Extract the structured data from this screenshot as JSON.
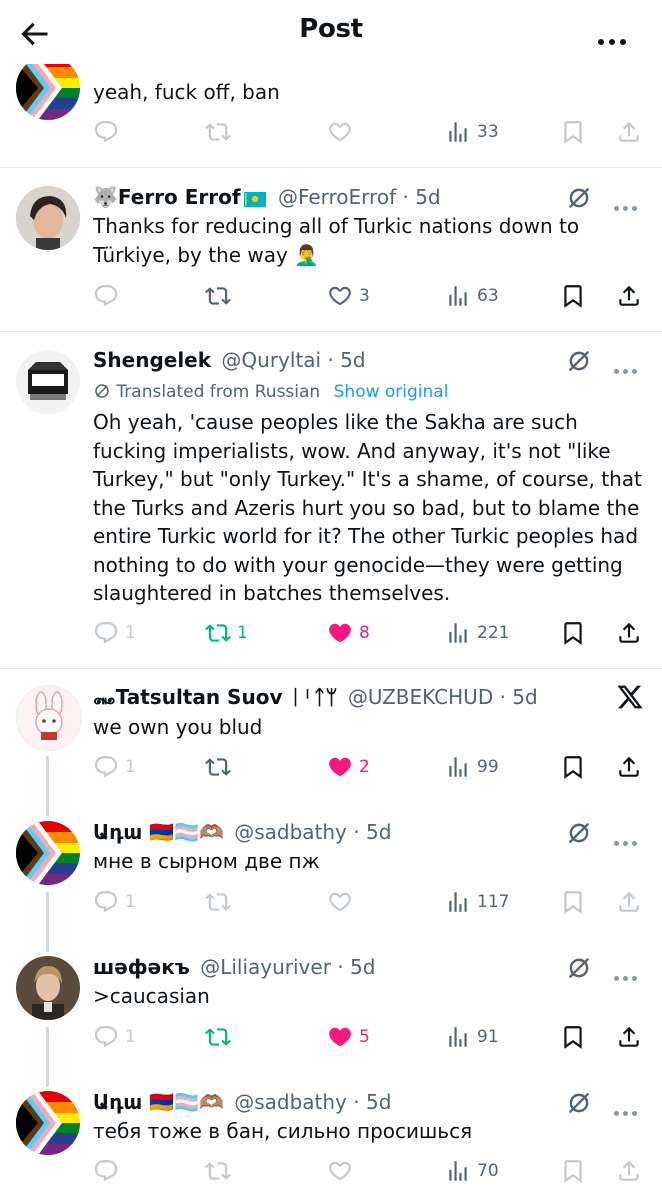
{
  "header": {
    "title": "Post"
  },
  "colors": {
    "retweet_active": "#00ba7c",
    "like_active": "#f91880",
    "link": "#1d9bf0",
    "muted": "#536471"
  },
  "icons": {
    "back": "arrow-left-icon",
    "more": "more-icon",
    "reply": "reply-icon",
    "retweet": "retweet-icon",
    "like": "heart-icon",
    "views": "views-icon",
    "bookmark": "bookmark-icon",
    "share": "share-icon",
    "grok": "grok-icon",
    "x_logo": "x-logo-icon"
  },
  "posts": [
    {
      "text": "yeah, fuck off, ban",
      "stats": {
        "views": "33"
      }
    },
    {
      "name": "🐺Ferro Errof",
      "handle": "@FerroErrof",
      "time": "· 5d",
      "text": "Thanks for reducing all of Turkic nations down to Türkiye, by the way 🤦‍♂️",
      "stats": {
        "likes": "3",
        "views": "63"
      }
    },
    {
      "name": "Shengelek",
      "handle": "@Quryltai",
      "time": "· 5d",
      "translated_label": "Translated from Russian",
      "show_original": "Show original",
      "text": "Oh yeah, 'cause peoples like the Sakha are such fucking imperialists, wow. And anyway, it's not \"like Turkey,\" but \"only Turkey.\" It's a shame, of course, that the Turks and Azeris hurt you so bad, but to blame the entire Turkic world for it? The other Turkic peoples had nothing to do with your genocide—they were getting slaughtered in batches themselves.",
      "stats": {
        "replies": "1",
        "retweets": "1",
        "likes": "8",
        "views": "221"
      }
    },
    {
      "name": "꘏Tatsultan Suov ᛁᛌᛏᛘ",
      "handle": "@UZBEKCHUD",
      "time": "· 5d",
      "text": "we own you blud",
      "stats": {
        "replies": "1",
        "likes": "2",
        "views": "99"
      }
    },
    {
      "name": "Ադա 🇦🇲🏳️‍⚧️🫶🏽",
      "handle": "@sadbathy",
      "time": "· 5d",
      "text": "мне в сырном две пж",
      "stats": {
        "replies": "1",
        "views": "117"
      }
    },
    {
      "name": "шәфәкъ",
      "handle": "@Liliayuriver",
      "time": "· 5d",
      "text": ">caucasian",
      "stats": {
        "replies": "1",
        "likes": "5",
        "views": "91"
      }
    },
    {
      "name": "Ադա 🇦🇲🏳️‍⚧️🫶🏽",
      "handle": "@sadbathy",
      "time": "· 5d",
      "text": "тебя тоже в бан, сильно просишься",
      "stats": {
        "views": "70"
      }
    }
  ]
}
